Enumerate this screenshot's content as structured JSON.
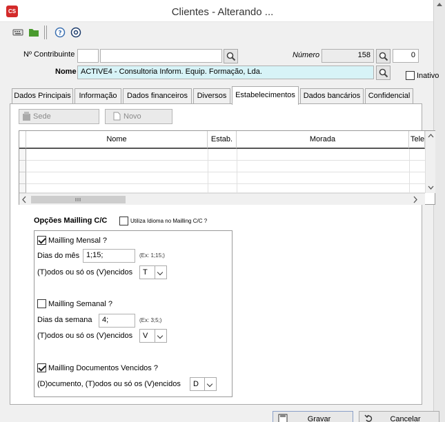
{
  "window": {
    "title": "Clientes - Alterando ...",
    "logo_text": "CS"
  },
  "header": {
    "contribuinte_label": "Nº Contribuinte",
    "contribuinte_value1": "",
    "contribuinte_value2": "",
    "numero_label": "Número",
    "numero_value": "158",
    "numero_sub_value": "0",
    "nome_label": "Nome",
    "nome_value": "ACTIVE4 - Consultoria Inform. Equip. Formação, Lda.",
    "inativo_label": "Inativo",
    "inativo_checked": false
  },
  "tabs": [
    {
      "label": "Dados Principais"
    },
    {
      "label": "Informação"
    },
    {
      "label": "Dados financeiros"
    },
    {
      "label": "Diversos"
    },
    {
      "label": "Estabelecimentos"
    },
    {
      "label": "Dados bancários"
    },
    {
      "label": "Confidencial"
    }
  ],
  "panel": {
    "sede_button": "Sede",
    "novo_button": "Novo",
    "grid": {
      "columns": [
        "Nome",
        "Estab.",
        "Morada",
        "Telefo"
      ]
    },
    "opcoes_label": "Opções Mailling C/C",
    "utiliza_idioma_label": "Utiliza Idioma no Mailling C/C ?",
    "mensal": {
      "label": "Mailling Mensal ?",
      "checked": true,
      "dias_label": "Dias do mês",
      "dias_value": "1;15;",
      "example": "(Ex: 1;15;)",
      "todos_label": "(T)odos ou só os (V)encidos",
      "todos_value": "T"
    },
    "semanal": {
      "label": "Mailling Semanal ?",
      "checked": false,
      "dias_label": "Dias da semana",
      "dias_value": "4;",
      "example": "(Ex: 3;5;)",
      "todos_label": "(T)odos ou só os (V)encidos",
      "todos_value": "V"
    },
    "vencidos": {
      "label": "Mailling Documentos Vencidos ?",
      "checked": true,
      "todos_label": "(D)ocumento, (T)odos ou só os (V)encidos",
      "todos_value": "D"
    }
  },
  "footer": {
    "gravar_label": "Gravar",
    "cancelar_label": "Cancelar"
  }
}
